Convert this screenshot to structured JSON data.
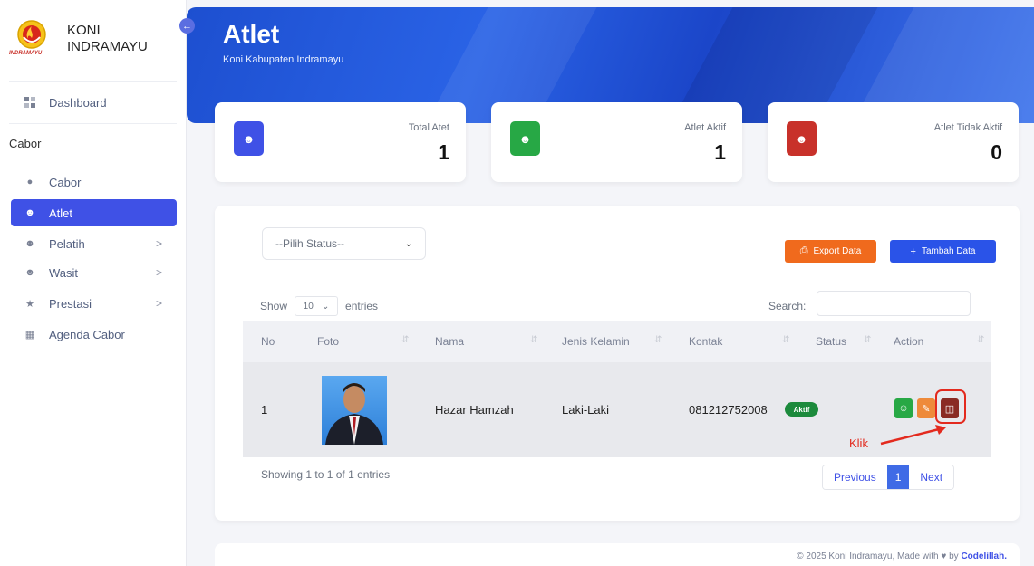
{
  "brand": {
    "line1": "KONI",
    "line2": "INDRAMAYU",
    "logo_text": "INDRAMAYU"
  },
  "sidebar": {
    "dashboard": "Dashboard",
    "section": "Cabor",
    "items": [
      {
        "label": "Cabor",
        "icon": "cabor-icon",
        "chevron": ""
      },
      {
        "label": "Atlet",
        "icon": "users-icon",
        "chevron": ""
      },
      {
        "label": "Pelatih",
        "icon": "users-icon",
        "chevron": ">"
      },
      {
        "label": "Wasit",
        "icon": "users-icon",
        "chevron": ">"
      },
      {
        "label": "Prestasi",
        "icon": "star-icon",
        "chevron": ">"
      },
      {
        "label": "Agenda Cabor",
        "icon": "calendar-icon",
        "chevron": ""
      }
    ]
  },
  "header": {
    "title": "Atlet",
    "subtitle": "Koni Kabupaten Indramayu"
  },
  "stats": [
    {
      "label": "Total Atet",
      "value": "1",
      "color": "#3f51e6"
    },
    {
      "label": "Atlet Aktif",
      "value": "1",
      "color": "#27a845"
    },
    {
      "label": "Atlet Tidak Aktif",
      "value": "0",
      "color": "#c8312a"
    }
  ],
  "filters": {
    "status_placeholder": "--Pilih Status--"
  },
  "buttons": {
    "export": "Export Data",
    "add": "Tambah Data"
  },
  "table_controls": {
    "show": "Show",
    "length": "10",
    "entries": "entries",
    "search_label": "Search:"
  },
  "table": {
    "columns": [
      "No",
      "Foto",
      "Nama",
      "Jenis Kelamin",
      "Kontak",
      "Status",
      "Action"
    ],
    "rows": [
      {
        "no": "1",
        "nama": "Hazar Hamzah",
        "jenis_kelamin": "Laki-Laki",
        "kontak": "081212752008",
        "status": "Aktif"
      }
    ]
  },
  "annotation": {
    "label": "Klik"
  },
  "info": "Showing 1 to 1 of 1 entries",
  "pagination": {
    "prev": "Previous",
    "current": "1",
    "next": "Next"
  },
  "footer": {
    "text": "© 2025 Koni Indramayu, Made with",
    "by": "by",
    "author": "Codelillah."
  }
}
